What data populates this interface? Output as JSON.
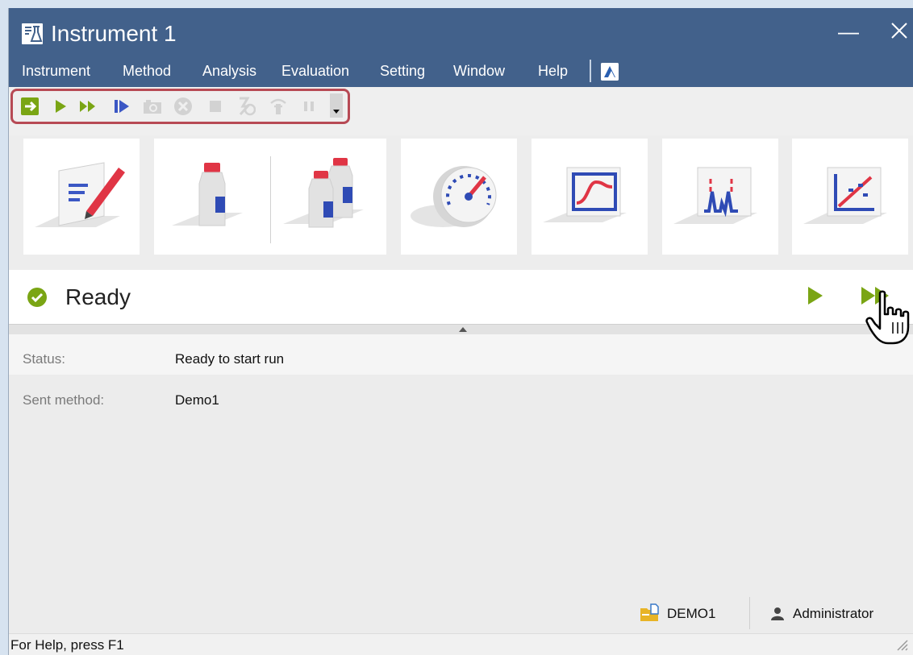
{
  "window": {
    "title": "Instrument 1"
  },
  "menu": {
    "items": [
      "Instrument",
      "Method",
      "Analysis",
      "Evaluation",
      "Setting",
      "Window",
      "Help"
    ]
  },
  "toolbar": {
    "icons": [
      "enter-icon",
      "play-icon",
      "fast-forward-icon",
      "step-play-icon",
      "camera-icon",
      "stop-circle-icon",
      "stop-icon",
      "reinject-icon",
      "standby-icon",
      "pause-icon"
    ]
  },
  "tiles": [
    "method-edit-icon",
    "single-vial-icon",
    "multi-vial-icon",
    "gauge-icon",
    "monitor-icon",
    "chromatogram-icon",
    "calibration-icon"
  ],
  "status_strip": {
    "label": "Ready"
  },
  "info": {
    "status_label": "Status:",
    "status_value": "Ready to start run",
    "sent_method_label": "Sent method:",
    "sent_method_value": "Demo1"
  },
  "footer": {
    "project": "DEMO1",
    "user": "Administrator"
  },
  "statusbar": {
    "text": "For Help, press F1"
  },
  "colors": {
    "titlebar": "#42618b",
    "accent_green": "#7aa514",
    "highlight_frame": "#b74a55",
    "toolbar_blue": "#3b57c4"
  }
}
